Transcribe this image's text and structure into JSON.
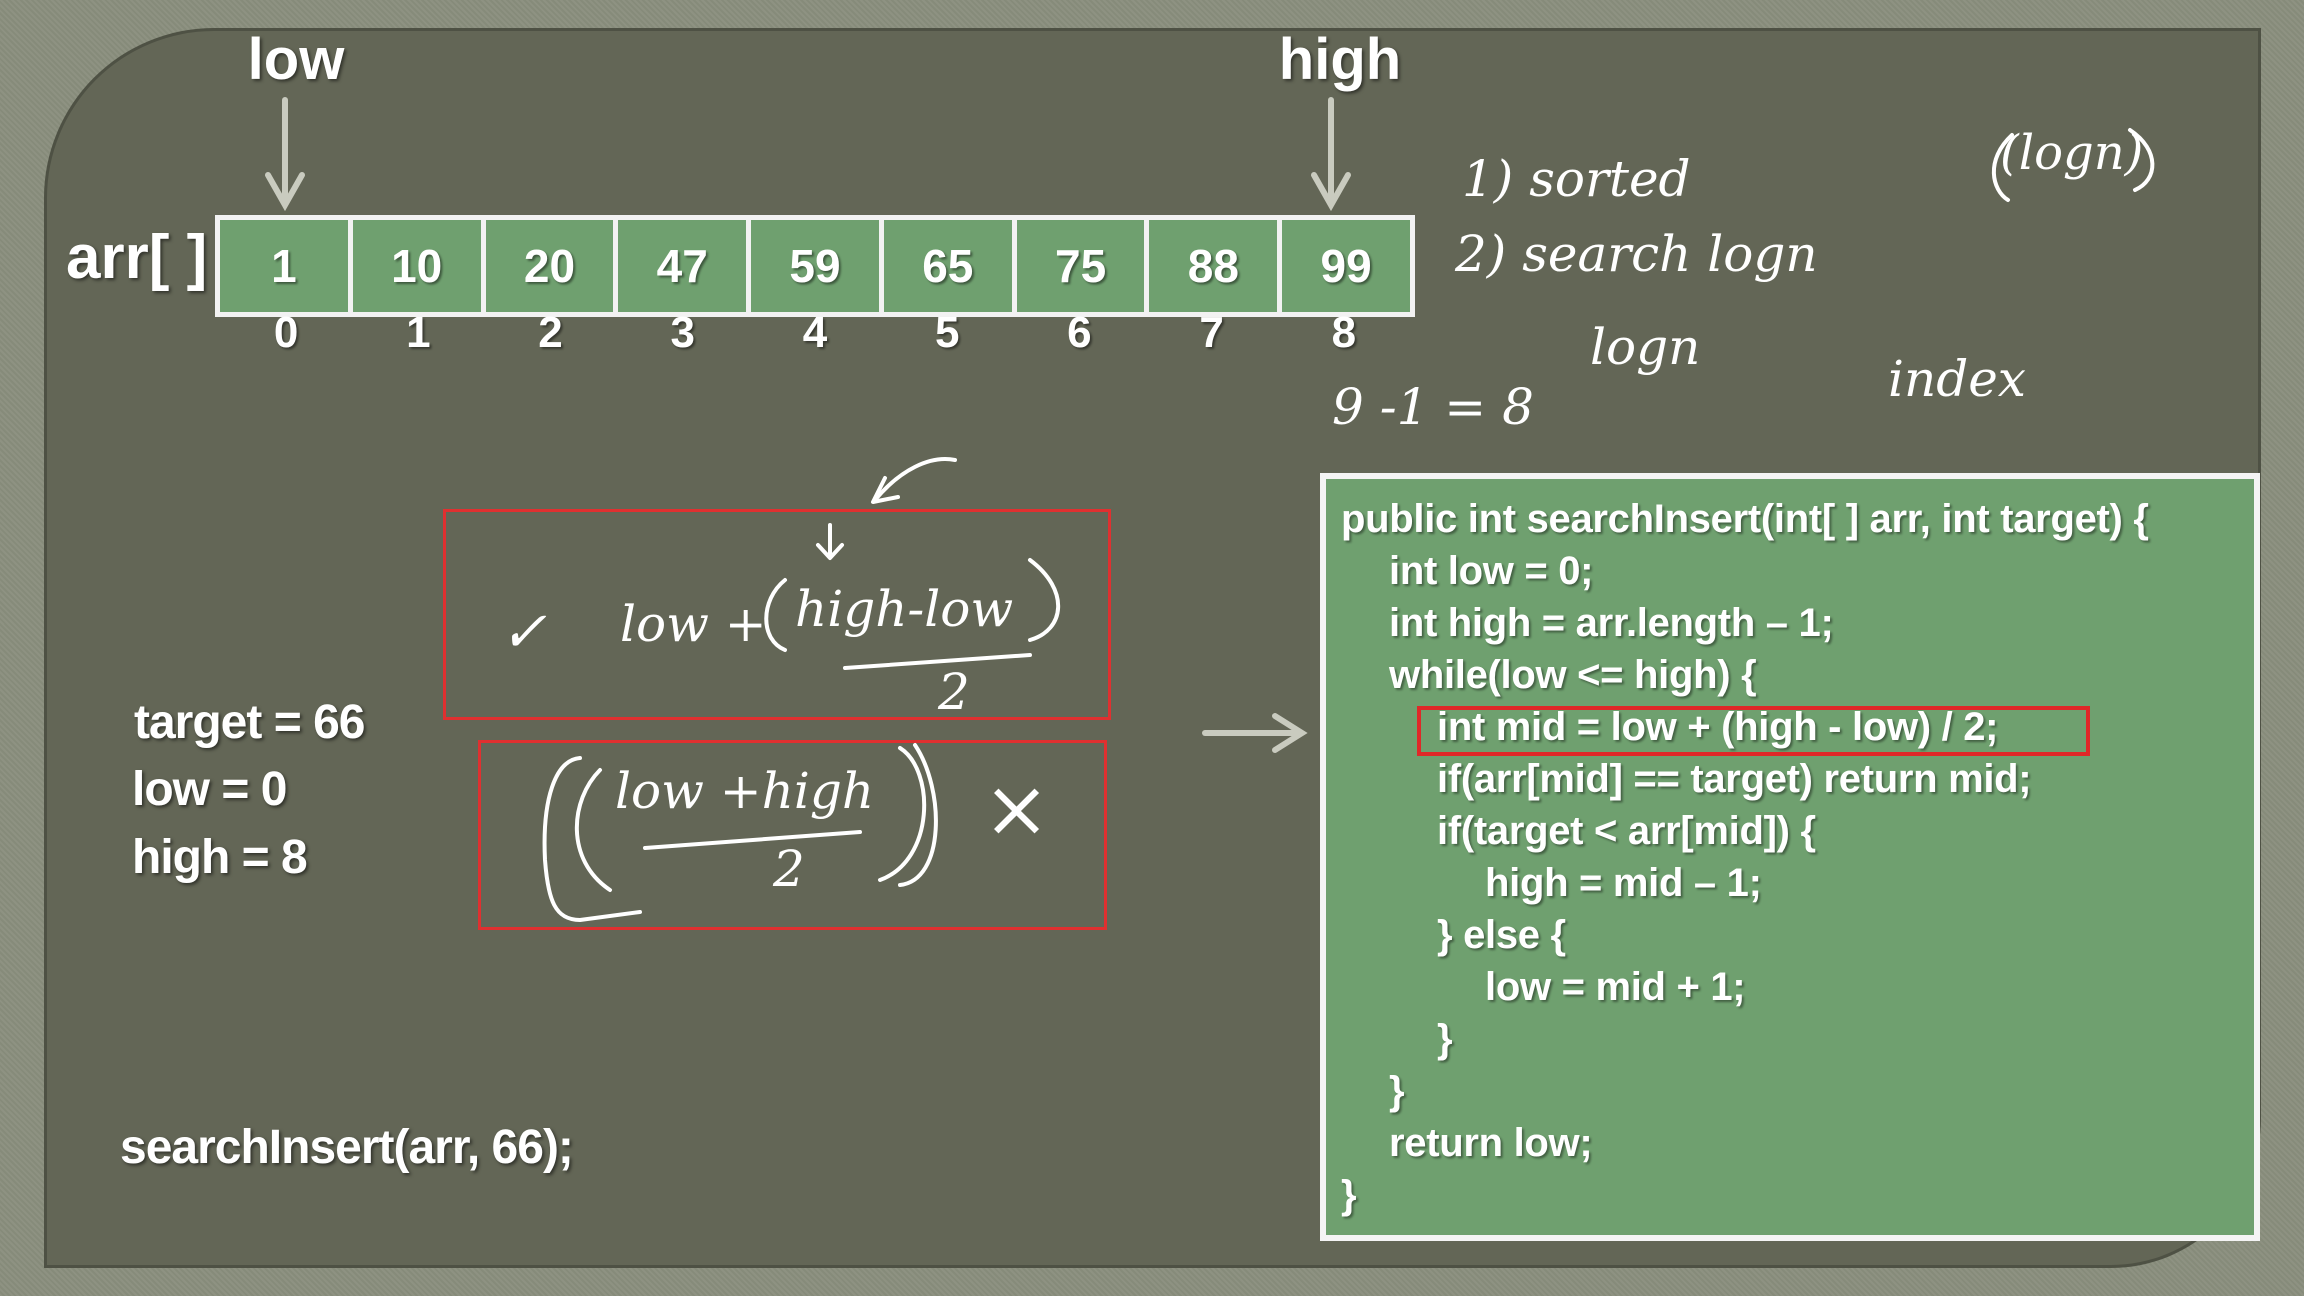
{
  "pointers": {
    "low_label": "low",
    "high_label": "high"
  },
  "array": {
    "label": "arr[ ]",
    "values": [
      "1",
      "10",
      "20",
      "47",
      "59",
      "65",
      "75",
      "88",
      "99"
    ],
    "indices": [
      "0",
      "1",
      "2",
      "3",
      "4",
      "5",
      "6",
      "7",
      "8"
    ]
  },
  "variables": {
    "target": "target = 66",
    "low": "low = 0",
    "high": "high = 8"
  },
  "call": "searchInsert(arr, 66);",
  "notes": {
    "n1": "1) sorted",
    "n2": "2) search  logn",
    "n3": "(logn)",
    "n4": "logn",
    "n5": "index",
    "n6": "9 -1 = 8"
  },
  "formula_good": {
    "check": "✓",
    "expr_left": "low +",
    "numer": "high-low",
    "denom": "2"
  },
  "formula_bad": {
    "numer": "low +high",
    "denom": "2",
    "cross": "×"
  },
  "code": [
    "public int searchInsert(int[ ] arr, int target) {",
    "int low = 0;",
    "int high = arr.length – 1;",
    "while(low <= high) {",
    "int mid = low + (high - low) / 2;",
    "if(arr[mid] == target) return mid;",
    "if(target < arr[mid]) {",
    "high = mid – 1;",
    "} else {",
    "low = mid + 1;",
    "}",
    "}",
    "return low;",
    "}"
  ],
  "colors": {
    "board": "#636656",
    "cell": "#6fa06f",
    "highlight": "#e02828"
  }
}
